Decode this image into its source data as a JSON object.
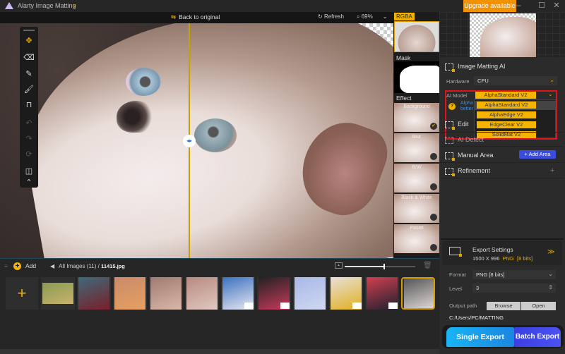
{
  "app": {
    "title": "Alarty Image Matting",
    "upgrade_label": "Upgrade available",
    "window_controls": [
      "minimize",
      "maximize",
      "close"
    ]
  },
  "toolbar": {
    "back_to_original": "Back to original",
    "refresh": "Refresh",
    "zoom_level": "69%"
  },
  "canvas": {
    "split_position_percent": 48
  },
  "tools": [
    {
      "name": "move-tool",
      "icon": "✥",
      "active": true
    },
    {
      "name": "eraser-tool",
      "icon": "⌫",
      "active": false
    },
    {
      "name": "pen-tool",
      "icon": "✎",
      "active": false
    },
    {
      "name": "brush-tool",
      "icon": "🖌",
      "active": false
    },
    {
      "name": "roller-tool",
      "icon": "⊓",
      "active": false
    },
    {
      "name": "undo-tool",
      "icon": "↶",
      "active": false,
      "disabled": true
    },
    {
      "name": "redo-tool",
      "icon": "↷",
      "active": false,
      "disabled": true
    },
    {
      "name": "reset-tool",
      "icon": "⟳",
      "active": false,
      "disabled": true
    },
    {
      "name": "frame-tool",
      "icon": "◫",
      "active": false
    },
    {
      "name": "collapse-tool",
      "icon": "⌃",
      "active": false
    }
  ],
  "side_strip": {
    "rgba_label": "RGBA",
    "mask_label": "Mask",
    "effect_label": "Effect",
    "effects": [
      {
        "label": "Background",
        "selected": true
      },
      {
        "label": "Blur",
        "selected": false
      },
      {
        "label": "B/W",
        "selected": false
      },
      {
        "label": "Black & White",
        "selected": false
      },
      {
        "label": "Pastel",
        "selected": false
      }
    ]
  },
  "panel": {
    "image_matting_title": "Image Matting AI",
    "hardware_label": "Hardware",
    "hardware_value": "CPU",
    "ai_model_label": "AI Model",
    "ai_model_value": "AlphaStandard  V2",
    "ai_model_options": [
      "AlphaStandard  V2",
      "AlphaEdge  V2",
      "EdgeClear  V2",
      "SolidMat  V2"
    ],
    "help_text_line1": "Alpha",
    "help_text_line2": "better",
    "edit_label": "Edit",
    "ai_detect_label": "AI Detect",
    "manual_area_label": "Manual Area",
    "add_area_label": "+ Add Area",
    "refinement_label": "Refinement"
  },
  "export": {
    "title": "Export Settings",
    "dimensions": "1500 X 996",
    "format_short": "PNG",
    "bits_short": "[8 bits]",
    "format_label": "Format",
    "format_value": "PNG  [8 bits]",
    "level_label": "Level",
    "level_value": "3",
    "output_path_label": "Output path",
    "browse_label": "Browse",
    "open_label": "Open",
    "output_path_value": "C:/Users/PC/MATTING",
    "single_export_label": "Single Export",
    "batch_export_label": "Batch Export"
  },
  "gallery": {
    "add_label": "Add",
    "breadcrumb_root": "All Images (11)",
    "breadcrumb_sep": "/",
    "current_file": "11415.jpg",
    "thumbnail_size_percent": 55,
    "items": [
      {
        "subject": "bicycle",
        "colors": [
          "#8a9a55",
          "#c9b36a"
        ],
        "badge": false
      },
      {
        "subject": "woman-red-dress-forest",
        "colors": [
          "#3d6a7a",
          "#7a1f2a"
        ],
        "badge": false
      },
      {
        "subject": "woman-flowers",
        "colors": [
          "#c88a6a",
          "#e8a060"
        ],
        "badge": false
      },
      {
        "subject": "woman-roses",
        "colors": [
          "#a07a70",
          "#d8b8a8"
        ],
        "badge": false
      },
      {
        "subject": "woman-roses-2",
        "colors": [
          "#b88a80",
          "#e0c8c0"
        ],
        "badge": false
      },
      {
        "subject": "wedding-dress-beach",
        "colors": [
          "#3a70c0",
          "#e8e8f0"
        ],
        "badge": true
      },
      {
        "subject": "candy-pattern",
        "colors": [
          "#222222",
          "#c83a5a"
        ],
        "badge": true
      },
      {
        "subject": "sneaker",
        "colors": [
          "#a8b8e8",
          "#d0d8f0"
        ],
        "badge": false
      },
      {
        "subject": "yellow-chair",
        "colors": [
          "#e8e0d8",
          "#e0b020"
        ],
        "badge": true
      },
      {
        "subject": "woman-colorful",
        "colors": [
          "#d04050",
          "#202030"
        ],
        "badge": true
      },
      {
        "subject": "cat",
        "colors": [
          "#555555",
          "#e8e0e0"
        ],
        "badge": false,
        "selected": true
      }
    ]
  }
}
